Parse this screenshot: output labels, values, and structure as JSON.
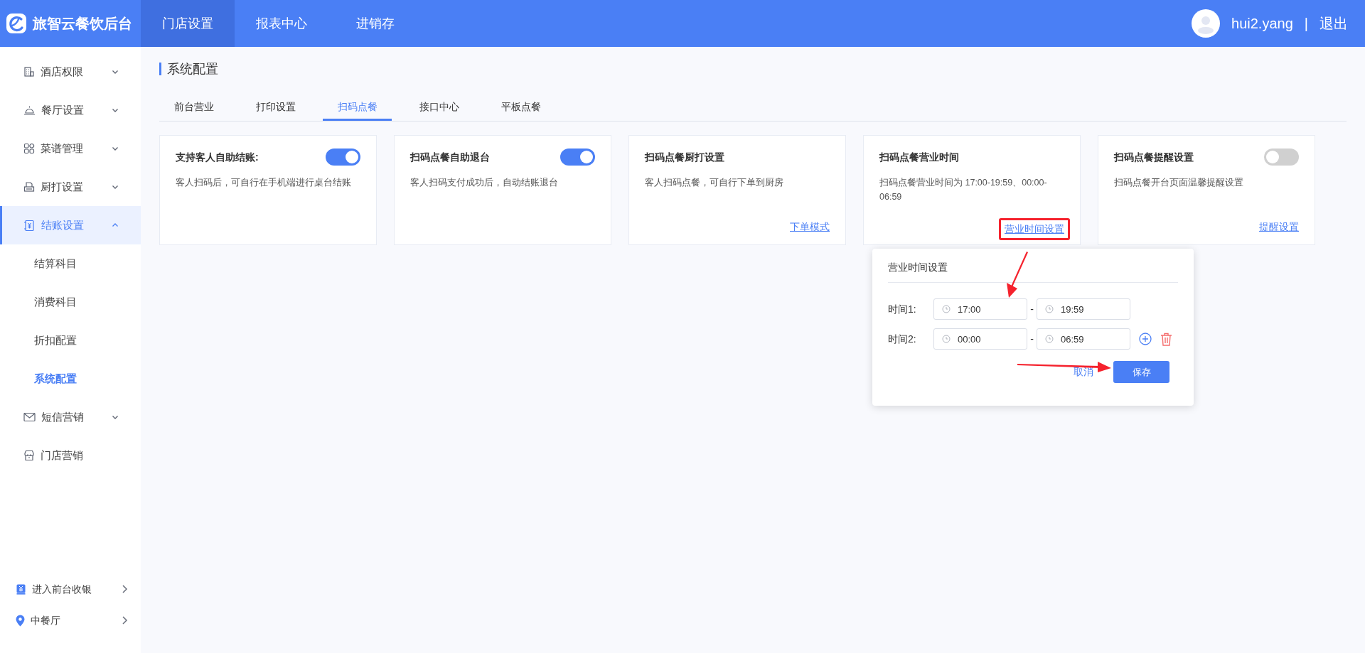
{
  "header": {
    "brand": "旅智云餐饮后台",
    "nav": [
      {
        "label": "门店设置",
        "selected": true
      },
      {
        "label": "报表中心",
        "selected": false
      },
      {
        "label": "进销存",
        "selected": false
      }
    ],
    "user": {
      "name": "hui2.yang",
      "separator": "|",
      "logout": "退出"
    }
  },
  "sidebar": {
    "items": [
      {
        "label": "酒店权限",
        "expanded": false,
        "selected": false
      },
      {
        "label": "餐厅设置",
        "expanded": false,
        "selected": false
      },
      {
        "label": "菜谱管理",
        "expanded": false,
        "selected": false
      },
      {
        "label": "厨打设置",
        "expanded": false,
        "selected": false
      },
      {
        "label": "结账设置",
        "expanded": true,
        "selected": true,
        "children": [
          {
            "label": "结算科目",
            "selected": false
          },
          {
            "label": "消费科目",
            "selected": false
          },
          {
            "label": "折扣配置",
            "selected": false
          },
          {
            "label": "系统配置",
            "selected": true
          }
        ]
      },
      {
        "label": "短信营销",
        "expanded": false,
        "selected": false
      },
      {
        "label": "门店营销",
        "selected": false
      }
    ],
    "footer_items": [
      {
        "label": "进入前台收银"
      },
      {
        "label": "中餐厅"
      }
    ]
  },
  "page": {
    "title": "系统配置",
    "tabs": [
      {
        "label": "前台营业",
        "selected": false
      },
      {
        "label": "打印设置",
        "selected": false
      },
      {
        "label": "扫码点餐",
        "selected": true
      },
      {
        "label": "接口中心",
        "selected": false
      },
      {
        "label": "平板点餐",
        "selected": false
      }
    ],
    "cards": [
      {
        "title": "支持客人自助结账:",
        "switch_on": true,
        "description": "客人扫码后，可自行在手机端进行桌台结账",
        "annotated": false
      },
      {
        "title": "扫码点餐自助退台",
        "switch_on": true,
        "description": "客人扫码支付成功后，自动结账退台",
        "annotated": false
      },
      {
        "title": "扫码点餐厨打设置",
        "description": "客人扫码点餐，可自行下单到厨房",
        "link": "下单模式",
        "annotated": false
      },
      {
        "title": "扫码点餐营业时间",
        "description": "扫码点餐营业时间为 17:00-19:59、00:00-06:59",
        "link": "营业时间设置",
        "annotated": true
      },
      {
        "title": "扫码点餐提醒设置",
        "switch_on": false,
        "description": "扫码点餐开台页面温馨提醒设置",
        "link": "提醒设置",
        "annotated": false
      }
    ]
  },
  "popover": {
    "title": "营业时间设置",
    "rows": [
      {
        "label": "时间1:",
        "start": "17:00",
        "separator": "-",
        "end": "19:59",
        "show_actions": false
      },
      {
        "label": "时间2:",
        "start": "00:00",
        "separator": "-",
        "end": "06:59",
        "show_actions": true
      }
    ],
    "cancel": "取消",
    "save": "保存"
  }
}
